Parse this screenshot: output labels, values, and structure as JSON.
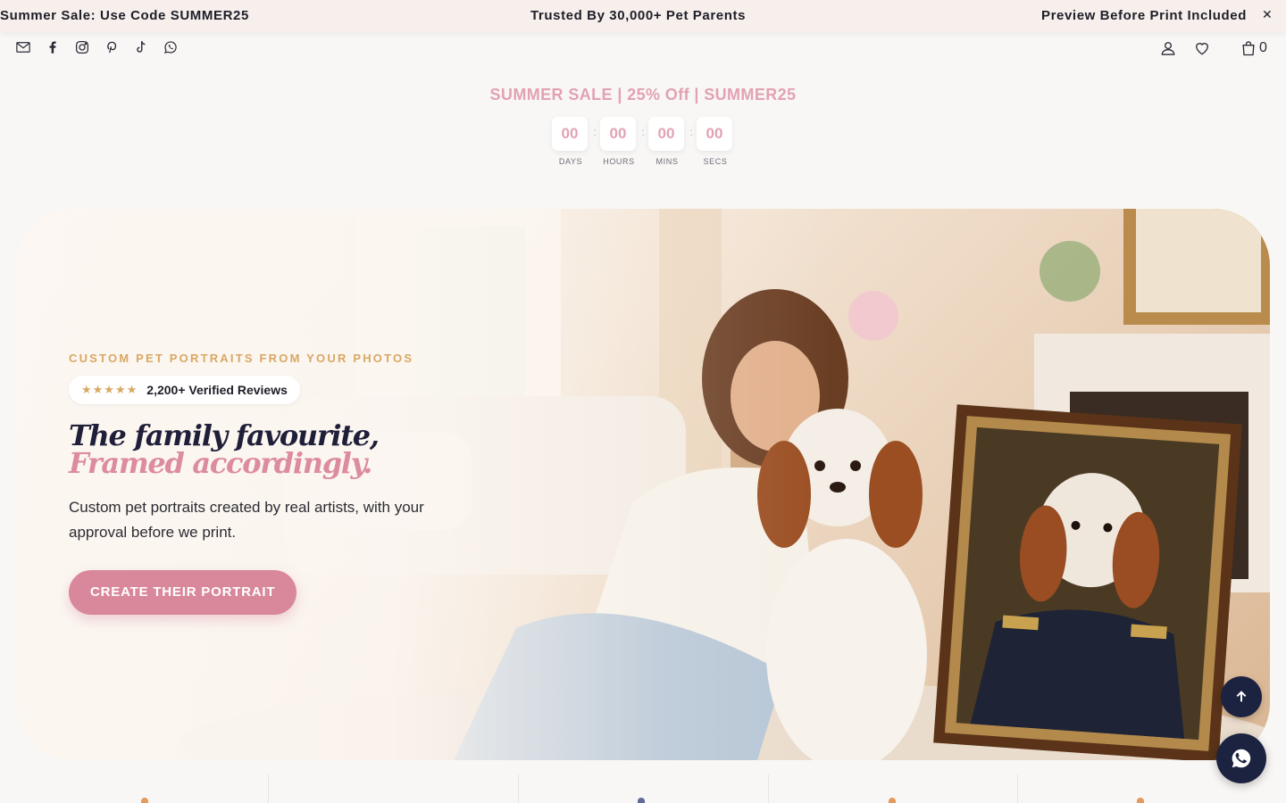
{
  "announcement": {
    "items": [
      "Summer Sale: Use Code SUMMER25",
      "Trusted By 30,000+ Pet Parents",
      "Preview Before Print Included"
    ],
    "close_icon": "close-icon"
  },
  "header": {
    "social_icons": [
      "mail-icon",
      "facebook-icon",
      "instagram-icon",
      "pinterest-icon",
      "tiktok-icon",
      "whatsapp-icon"
    ],
    "account_icons": [
      "user-icon",
      "heart-icon",
      "bag-icon"
    ],
    "cart_count": "0"
  },
  "countdown": {
    "title": "SUMMER SALE | 25% Off | SUMMER25",
    "units": [
      {
        "value": "00",
        "label": "DAYS"
      },
      {
        "value": "00",
        "label": "HOURS"
      },
      {
        "value": "00",
        "label": "MINS"
      },
      {
        "value": "00",
        "label": "SECS"
      }
    ],
    "separator": ":"
  },
  "hero": {
    "eyebrow": "CUSTOM PET PORTRAITS FROM YOUR PHOTOS",
    "stars": "★★★★★",
    "reviews": "2,200+ Verified Reviews",
    "headline_line1": "The family favourite,",
    "headline_line2": "Framed accordingly.",
    "subcopy": "Custom pet portraits created by real artists, with your approval before we print.",
    "cta": "CREATE THEIR PORTRAIT"
  },
  "floating": {
    "back_to_top_icon": "arrow-up-icon",
    "chat_icon": "whatsapp-icon"
  },
  "colors": {
    "accent_pink": "#d8889a",
    "gold": "#d9a763",
    "navy": "#1c2340",
    "announce_bg": "#f6efec"
  }
}
